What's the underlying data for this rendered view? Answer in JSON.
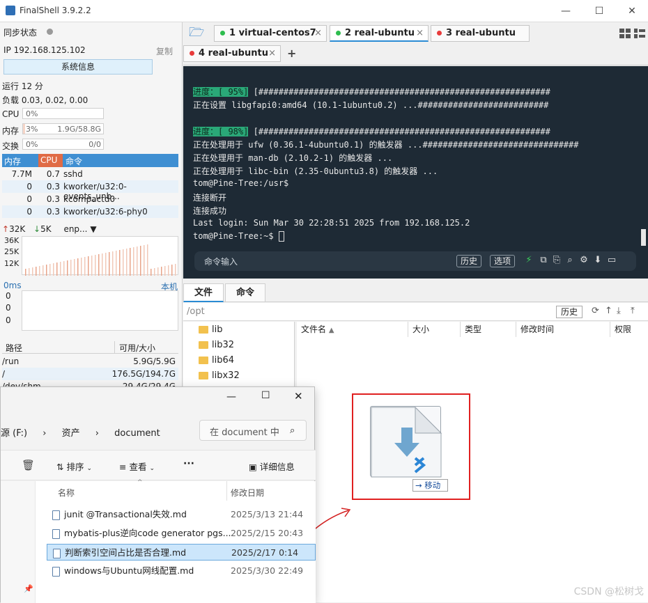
{
  "window": {
    "title": "FinalShell 3.9.2.2",
    "min": "—",
    "max": "☐",
    "close": "✕"
  },
  "sidebar": {
    "sync_label": "同步状态",
    "ip": "IP 192.168.125.102",
    "copy": "复制",
    "sysinfo_button": "系统信息",
    "uptime": "运行 12 分",
    "load": "负载 0.03, 0.02, 0.00",
    "cpu": {
      "label": "CPU",
      "value": "0%",
      "fraction": 0.0
    },
    "mem": {
      "label": "内存",
      "value": "3%",
      "detail": "1.9G/58.8G",
      "fraction": 0.03
    },
    "swap": {
      "label": "交换",
      "value": "0%",
      "detail": "0/0",
      "fraction": 0.0
    },
    "proc_headers": [
      "内存",
      "CPU",
      "命令"
    ],
    "processes": [
      {
        "mem": "7.7M",
        "cpu": "0.7",
        "cmd": "sshd"
      },
      {
        "mem": "0",
        "cpu": "0.3",
        "cmd": "kworker/u32:0-events_unb..."
      },
      {
        "mem": "0",
        "cpu": "0.3",
        "cmd": "kcompactd0"
      },
      {
        "mem": "0",
        "cpu": "0.3",
        "cmd": "kworker/u32:6-phy0"
      }
    ],
    "net": {
      "up": "32K",
      "down": "5K",
      "iface": "enp...",
      "ticks": [
        "36K",
        "25K",
        "12K"
      ]
    },
    "latency": {
      "label": "0ms",
      "host": "本机",
      "ticks": [
        "0",
        "0",
        "0"
      ]
    },
    "disk_headers": [
      "路径",
      "可用/大小"
    ],
    "disks": [
      {
        "path": "/run",
        "size": "5.9G/5.9G"
      },
      {
        "path": "/",
        "size": "176.5G/194.7G"
      },
      {
        "path": "/dev/shm",
        "size": "29.4G/29.4G"
      }
    ]
  },
  "tabs": [
    {
      "label": "1 virtual-centos7",
      "color": "#2ebd4e"
    },
    {
      "label": "2 real-ubuntu",
      "color": "#2ebd4e"
    },
    {
      "label": "3 real-ubuntu",
      "color": "#e83b3b"
    },
    {
      "label": "4 real-ubuntu",
      "color": "#e83b3b"
    }
  ],
  "tab_close": "×",
  "add_tab": "+",
  "terminal": {
    "progress1": "进度：[ 95%]",
    "bar1": " [##########################################################",
    "line2": "正在设置 libgfapi0:amd64 (10.1-1ubuntu0.2) ...##########################",
    "progress2": "进度：[ 98%]",
    "bar2": " [##########################################################",
    "line4": "正在处理用于 ufw (0.36.1-4ubuntu0.1) 的触发器 ...###############################",
    "line5": "正在处理用于 man-db (2.10.2-1) 的触发器 ...",
    "line6": "正在处理用于 libc-bin (2.35-0ubuntu3.8) 的触发器 ...",
    "line7": "tom@Pine-Tree:/usr$",
    "line8": "连接断开",
    "line9": "连接成功",
    "line10": "Last login: Sun Mar 30 22:28:51 2025 from 192.168.125.2",
    "line11": "tom@Pine-Tree:~$ "
  },
  "cmdbar": {
    "placeholder": "命令输入",
    "history": "历史",
    "options": "选项"
  },
  "filetabs": [
    "文件",
    "命令"
  ],
  "pathbar": {
    "path": "/opt",
    "history": "历史"
  },
  "tree": [
    "lib",
    "lib32",
    "lib64",
    "libx32"
  ],
  "columns": [
    "文件名",
    "大小",
    "类型",
    "修改时间",
    "权限"
  ],
  "explorer": {
    "crumbs": [
      "源 (F:)",
      "资产",
      "document"
    ],
    "search_placeholder": "在 document 中",
    "toolbar": {
      "sort": "排序",
      "view": "查看",
      "more": "···",
      "details": "详细信息"
    },
    "headers": [
      "名称",
      "修改日期"
    ],
    "files": [
      {
        "name": "junit @Transactional失效.md",
        "date": "2025/3/13 21:44"
      },
      {
        "name": "mybatis-plus逆向code generator pgs...",
        "date": "2025/2/15 20:43"
      },
      {
        "name": "判断索引空间占比是否合理.md",
        "date": "2025/2/17 0:14"
      },
      {
        "name": "windows与Ubuntu网线配置.md",
        "date": "2025/3/30 22:49"
      }
    ]
  },
  "drag": {
    "badge": "移动"
  },
  "watermark": "CSDN @松树戈"
}
